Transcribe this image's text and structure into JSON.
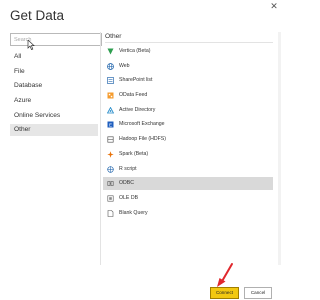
{
  "dialog": {
    "title": "Get Data",
    "close_glyph": "✕"
  },
  "search": {
    "placeholder": "Search"
  },
  "categories": [
    {
      "label": "All",
      "selected": false
    },
    {
      "label": "File",
      "selected": false
    },
    {
      "label": "Database",
      "selected": false
    },
    {
      "label": "Azure",
      "selected": false
    },
    {
      "label": "Online Services",
      "selected": false
    },
    {
      "label": "Other",
      "selected": true
    }
  ],
  "source_panel": {
    "heading": "Other",
    "items": [
      {
        "label": "Vertica (Beta)",
        "icon": "vertica-icon",
        "selected": false
      },
      {
        "label": "Web",
        "icon": "globe-icon",
        "selected": false
      },
      {
        "label": "SharePoint list",
        "icon": "sharepoint-icon",
        "selected": false
      },
      {
        "label": "OData Feed",
        "icon": "odata-icon",
        "selected": false
      },
      {
        "label": "Active Directory",
        "icon": "active-directory-icon",
        "selected": false
      },
      {
        "label": "Microsoft Exchange",
        "icon": "exchange-icon",
        "selected": false
      },
      {
        "label": "Hadoop File (HDFS)",
        "icon": "hadoop-icon",
        "selected": false
      },
      {
        "label": "Spark (Beta)",
        "icon": "spark-icon",
        "selected": false
      },
      {
        "label": "R script",
        "icon": "r-script-icon",
        "selected": false
      },
      {
        "label": "ODBC",
        "icon": "odbc-icon",
        "selected": true
      },
      {
        "label": "OLE DB",
        "icon": "oledb-icon",
        "selected": false
      },
      {
        "label": "Blank Query",
        "icon": "blank-query-icon",
        "selected": false
      }
    ]
  },
  "footer": {
    "connect_label": "Connect",
    "cancel_label": "Cancel"
  },
  "colors": {
    "accent_yellow": "#f2c811",
    "selection_gray": "#d9d9d9",
    "annotation_red": "#e0282d"
  }
}
